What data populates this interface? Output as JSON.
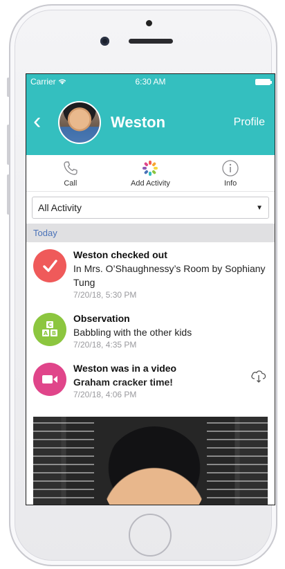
{
  "status_bar": {
    "carrier": "Carrier",
    "time": "6:30 AM"
  },
  "header": {
    "name": "Weston",
    "profile_label": "Profile"
  },
  "actions": [
    {
      "label": "Call",
      "icon": "phone-icon"
    },
    {
      "label": "Add Activity",
      "icon": "pinwheel-icon"
    },
    {
      "label": "Info",
      "icon": "info-icon"
    }
  ],
  "filter": {
    "selected": "All Activity"
  },
  "section": {
    "label": "Today"
  },
  "feed": [
    {
      "title": "Weston checked out",
      "description": "In Mrs. O’Shaughnessy’s Room by Sophiany Tung",
      "time": "7/20/18, 5:30 PM",
      "icon": "checkmark-icon",
      "color": "#ef5a5a"
    },
    {
      "title": "Observation",
      "description": "Babbling with the other kids",
      "time": "7/20/18, 4:35 PM",
      "icon": "blocks-icon",
      "color": "#8cc63f"
    },
    {
      "title": "Weston was in a video",
      "description": "Graham cracker time!",
      "time": "7/20/18, 4:06 PM",
      "icon": "video-camera-icon",
      "color": "#e0458a"
    }
  ],
  "colors": {
    "header": "#34bfbf",
    "section_text": "#4a72b8"
  }
}
